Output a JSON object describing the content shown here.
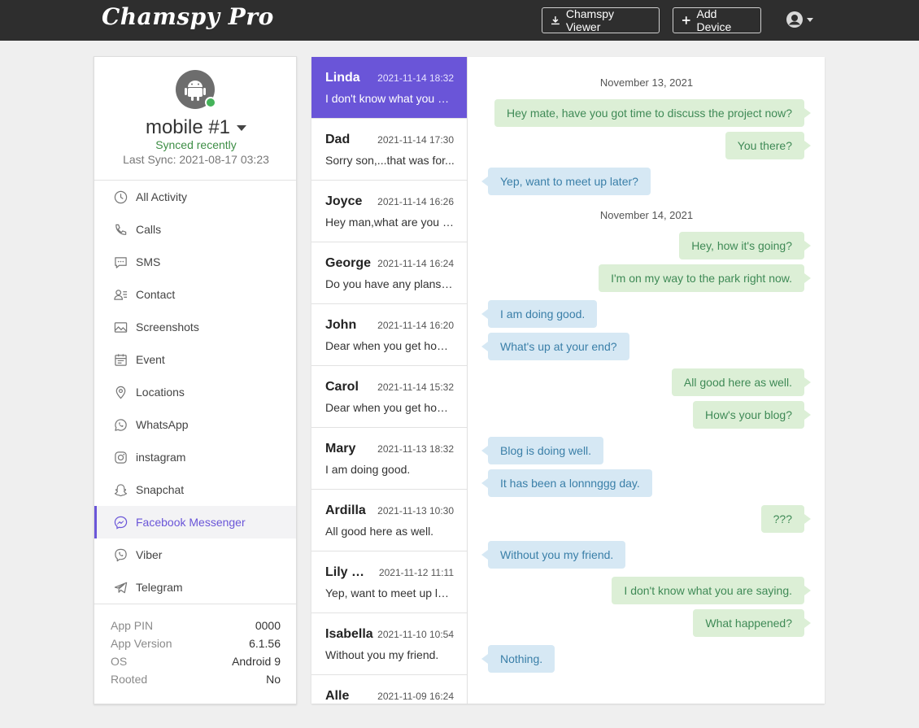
{
  "header": {
    "brand": "Chamspy Pro",
    "viewer_label": "Chamspy Viewer",
    "add_device_label": "Add Device"
  },
  "device": {
    "name": "mobile #1",
    "status": "Synced recently",
    "last_sync": "Last Sync: 2021-08-17 03:23",
    "online_color": "#45b35a"
  },
  "nav": [
    {
      "label": "All Activity",
      "icon": "clock-icon"
    },
    {
      "label": "Calls",
      "icon": "phone-icon"
    },
    {
      "label": "SMS",
      "icon": "message-icon"
    },
    {
      "label": "Contact",
      "icon": "contact-icon"
    },
    {
      "label": "Screenshots",
      "icon": "image-icon"
    },
    {
      "label": "Event",
      "icon": "calendar-icon"
    },
    {
      "label": "Locations",
      "icon": "map-pin-icon"
    },
    {
      "label": "WhatsApp",
      "icon": "whatsapp-icon"
    },
    {
      "label": "instagram",
      "icon": "instagram-icon"
    },
    {
      "label": "Snapchat",
      "icon": "snapchat-icon"
    },
    {
      "label": "Facebook Messenger",
      "icon": "messenger-icon"
    },
    {
      "label": "Viber",
      "icon": "viber-icon"
    },
    {
      "label": "Telegram",
      "icon": "telegram-icon"
    }
  ],
  "active_nav": "Facebook Messenger",
  "device_info": [
    {
      "key": "App PIN",
      "value": "0000"
    },
    {
      "key": "App Version",
      "value": "6.1.56"
    },
    {
      "key": "OS",
      "value": "Android 9"
    },
    {
      "key": "Rooted",
      "value": "No"
    }
  ],
  "conversations": [
    {
      "name": "Linda",
      "time": "2021-11-14 18:32",
      "preview": "I don't know what you are saying."
    },
    {
      "name": "Dad",
      "time": "2021-11-14 17:30",
      "preview": "Sorry son,...that was for..."
    },
    {
      "name": "Joyce",
      "time": "2021-11-14 16:26",
      "preview": "Hey man,what are you doing?"
    },
    {
      "name": "George",
      "time": "2021-11-14 16:24",
      "preview": "Do you have any plans for tonight?"
    },
    {
      "name": "John",
      "time": "2021-11-14 16:20",
      "preview": "Dear when you get home tonight"
    },
    {
      "name": "Carol",
      "time": "2021-11-14 15:32",
      "preview": "Dear when you get home tonight"
    },
    {
      "name": "Mary",
      "time": "2021-11-13 18:32",
      "preview": "I am doing good."
    },
    {
      "name": "Ardilla",
      "time": "2021-11-13 10:30",
      "preview": "All good here as well."
    },
    {
      "name": "Lily Walker",
      "time": "2021-11-12 11:11",
      "preview": "Yep, want to meet up later?"
    },
    {
      "name": "Isabella",
      "time": "2021-11-10 10:54",
      "preview": "Without you my friend."
    },
    {
      "name": "Alle",
      "time": "2021-11-09 16:24",
      "preview": ""
    }
  ],
  "active_conversation": "Linda",
  "thread": {
    "dates": [
      "November 13, 2021",
      "November 14, 2021"
    ],
    "messages": [
      {
        "dir": "out",
        "text": "Hey mate, have you got time to discuss the project now?"
      },
      {
        "dir": "out",
        "text": "You there?"
      },
      {
        "dir": "in",
        "text": "Yep, want to meet up later?"
      },
      {
        "dir": "out",
        "text": "Hey, how it's going?"
      },
      {
        "dir": "out",
        "text": "I'm on my way to the park right now."
      },
      {
        "dir": "in",
        "text": "I am doing good."
      },
      {
        "dir": "in",
        "text": "What's up at your end?"
      },
      {
        "dir": "out",
        "text": "All good here as well."
      },
      {
        "dir": "out",
        "text": "How's your blog?"
      },
      {
        "dir": "in",
        "text": "Blog is doing well."
      },
      {
        "dir": "in",
        "text": "It has been a lonnnggg day."
      },
      {
        "dir": "out",
        "text": "???"
      },
      {
        "dir": "in",
        "text": "Without you my friend."
      },
      {
        "dir": "out",
        "text": "I don't know what you are saying."
      },
      {
        "dir": "out",
        "text": "What happened?"
      },
      {
        "dir": "in",
        "text": "Nothing."
      }
    ]
  },
  "colors": {
    "accent": "#6a55d8",
    "outgoing_bg": "#dcefd6",
    "outgoing_text": "#3f8a56",
    "incoming_bg": "#d6e8f4",
    "incoming_text": "#3a7fa8"
  }
}
